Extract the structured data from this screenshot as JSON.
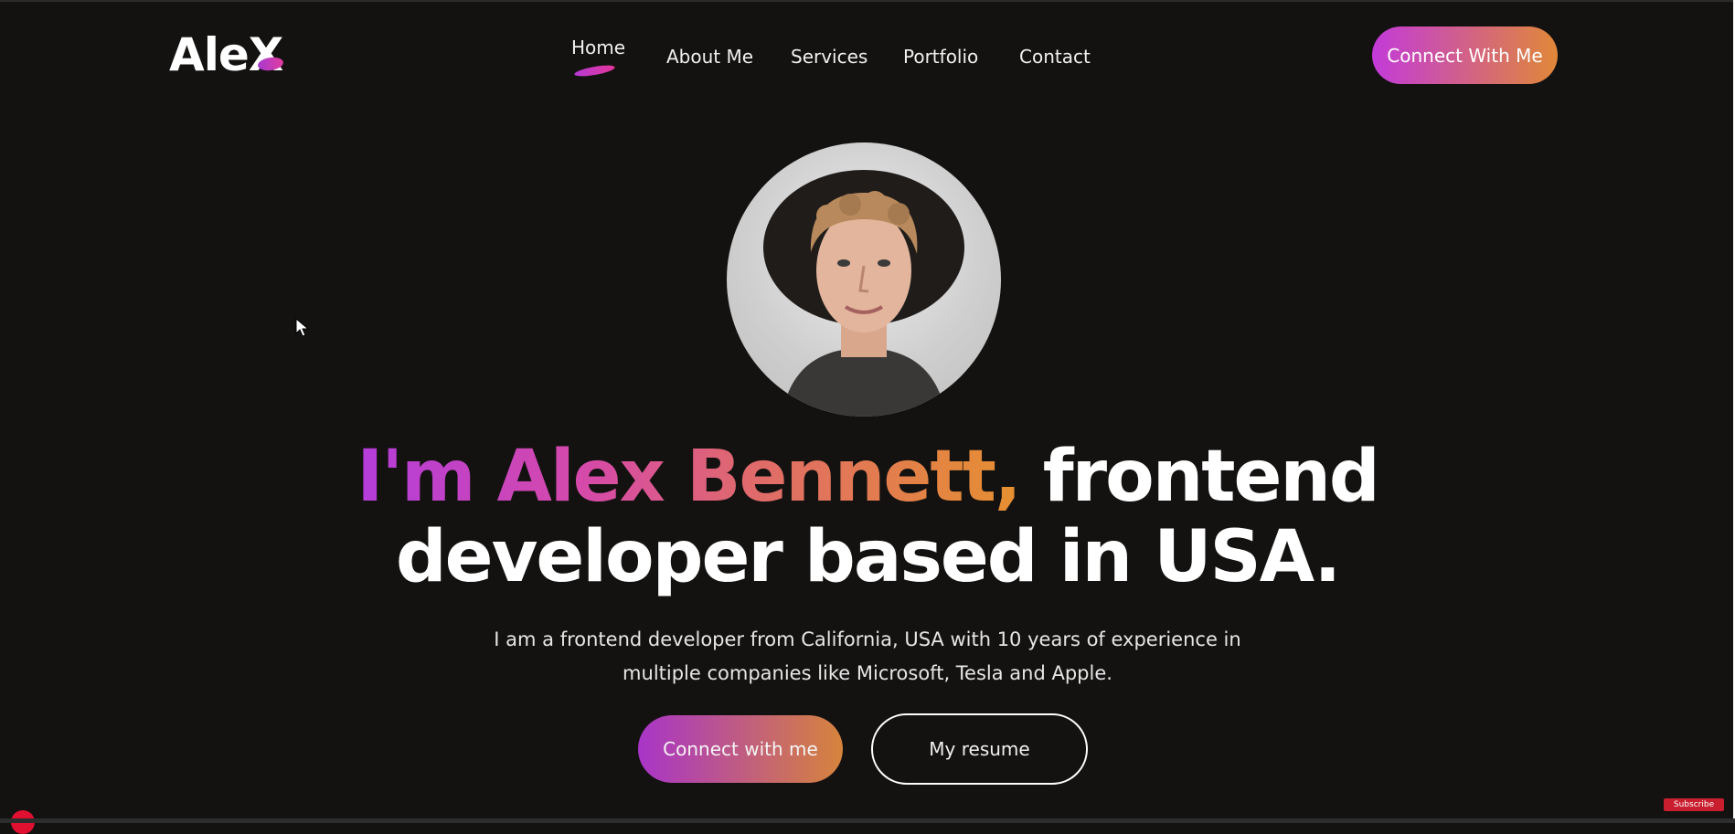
{
  "brand": {
    "logo_text": "AleX"
  },
  "nav": {
    "items": [
      {
        "label": "Home",
        "active": true
      },
      {
        "label": "About Me"
      },
      {
        "label": "Services"
      },
      {
        "label": "Portfolio"
      },
      {
        "label": "Contact"
      }
    ],
    "cta_label": "Connect With Me"
  },
  "hero": {
    "headline_name": "I'm Alex Bennett,",
    "headline_rest_line1": " frontend",
    "headline_line2": "developer based in USA.",
    "description": "I am a frontend developer from California, USA with 10 years of experience in multiple companies like Microsoft, Tesla and Apple.",
    "primary_button": "Connect with me",
    "secondary_button": "My resume"
  },
  "overlay": {
    "subscribe_label": "Subscribe"
  },
  "colors": {
    "background": "#141211",
    "accent_start": "#b43ddb",
    "accent_end": "#e59030"
  }
}
